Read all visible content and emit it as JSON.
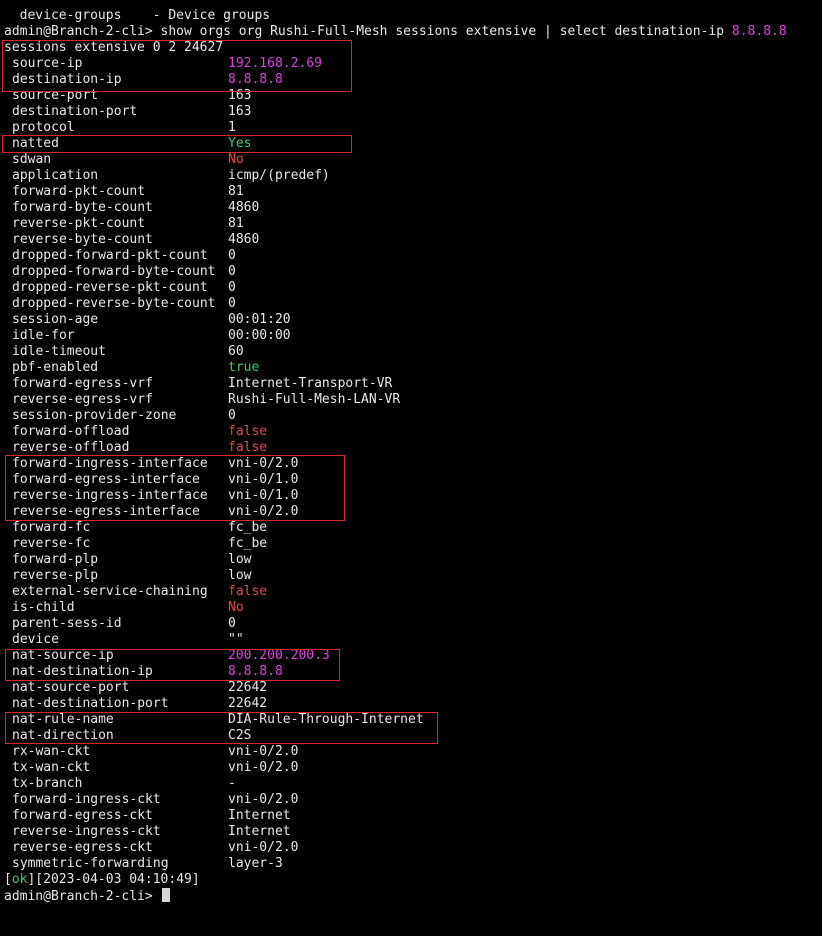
{
  "colors": {
    "background": "#000000",
    "default_text": "#e8e8e8",
    "magenta": "#e040e0",
    "green": "#3ccc6c",
    "red": "#e84848",
    "highlight_box": "#d4282f"
  },
  "header": {
    "device_groups_line": "  device-groups    - Device groups",
    "prompt_line_prefix": "admin@Branch-2-cli> show orgs org Rushi-Full-Mesh sessions extensive | select destination-ip ",
    "prompt_line_arg": "8.8.8.8",
    "session_title": "sessions extensive 0 2 24627"
  },
  "fields": [
    {
      "key": "source-ip",
      "value": "192.168.2.69",
      "color": "magenta"
    },
    {
      "key": "destination-ip",
      "value": "8.8.8.8",
      "color": "magenta"
    },
    {
      "key": "source-port",
      "value": "163",
      "color": "default"
    },
    {
      "key": "destination-port",
      "value": "163",
      "color": "default"
    },
    {
      "key": "protocol",
      "value": "1",
      "color": "default"
    },
    {
      "key": "natted",
      "value": "Yes",
      "color": "green"
    },
    {
      "key": "sdwan",
      "value": "No",
      "color": "red"
    },
    {
      "key": "application",
      "value": "icmp/(predef)",
      "color": "default"
    },
    {
      "key": "forward-pkt-count",
      "value": "81",
      "color": "default"
    },
    {
      "key": "forward-byte-count",
      "value": "4860",
      "color": "default"
    },
    {
      "key": "reverse-pkt-count",
      "value": "81",
      "color": "default"
    },
    {
      "key": "reverse-byte-count",
      "value": "4860",
      "color": "default"
    },
    {
      "key": "dropped-forward-pkt-count",
      "value": "0",
      "color": "default"
    },
    {
      "key": "dropped-forward-byte-count",
      "value": "0",
      "color": "default"
    },
    {
      "key": "dropped-reverse-pkt-count",
      "value": "0",
      "color": "default"
    },
    {
      "key": "dropped-reverse-byte-count",
      "value": "0",
      "color": "default"
    },
    {
      "key": "session-age",
      "value": "00:01:20",
      "color": "default"
    },
    {
      "key": "idle-for",
      "value": "00:00:00",
      "color": "default"
    },
    {
      "key": "idle-timeout",
      "value": "60",
      "color": "default"
    },
    {
      "key": "pbf-enabled",
      "value": "true",
      "color": "green"
    },
    {
      "key": "forward-egress-vrf",
      "value": "Internet-Transport-VR",
      "color": "default"
    },
    {
      "key": "reverse-egress-vrf",
      "value": "Rushi-Full-Mesh-LAN-VR",
      "color": "default"
    },
    {
      "key": "session-provider-zone",
      "value": "0",
      "color": "default"
    },
    {
      "key": "forward-offload",
      "value": "false",
      "color": "red"
    },
    {
      "key": "reverse-offload",
      "value": "false",
      "color": "red"
    },
    {
      "key": "forward-ingress-interface",
      "value": "vni-0/2.0",
      "color": "default"
    },
    {
      "key": "forward-egress-interface",
      "value": "vni-0/1.0",
      "color": "default"
    },
    {
      "key": "reverse-ingress-interface",
      "value": "vni-0/1.0",
      "color": "default"
    },
    {
      "key": "reverse-egress-interface",
      "value": "vni-0/2.0",
      "color": "default"
    },
    {
      "key": "forward-fc",
      "value": "fc_be",
      "color": "default"
    },
    {
      "key": "reverse-fc",
      "value": "fc_be",
      "color": "default"
    },
    {
      "key": "forward-plp",
      "value": "low",
      "color": "default"
    },
    {
      "key": "reverse-plp",
      "value": "low",
      "color": "default"
    },
    {
      "key": "external-service-chaining",
      "value": "false",
      "color": "red"
    },
    {
      "key": "is-child",
      "value": "No",
      "color": "red"
    },
    {
      "key": "parent-sess-id",
      "value": "0",
      "color": "default"
    },
    {
      "key": "device",
      "value": "\"\"",
      "color": "default"
    },
    {
      "key": "nat-source-ip",
      "value": "200.200.200.3",
      "color": "magenta"
    },
    {
      "key": "nat-destination-ip",
      "value": "8.8.8.8",
      "color": "magenta"
    },
    {
      "key": "nat-source-port",
      "value": "22642",
      "color": "default"
    },
    {
      "key": "nat-destination-port",
      "value": "22642",
      "color": "default"
    },
    {
      "key": "nat-rule-name",
      "value": "DIA-Rule-Through-Internet",
      "color": "default"
    },
    {
      "key": "nat-direction",
      "value": "C2S",
      "color": "default"
    },
    {
      "key": "rx-wan-ckt",
      "value": "vni-0/2.0",
      "color": "default"
    },
    {
      "key": "tx-wan-ckt",
      "value": "vni-0/2.0",
      "color": "default"
    },
    {
      "key": "tx-branch",
      "value": "-",
      "color": "default"
    },
    {
      "key": "forward-ingress-ckt",
      "value": "vni-0/2.0",
      "color": "default"
    },
    {
      "key": "forward-egress-ckt",
      "value": "Internet",
      "color": "default"
    },
    {
      "key": "reverse-ingress-ckt",
      "value": "Internet",
      "color": "default"
    },
    {
      "key": "reverse-egress-ckt",
      "value": "vni-0/2.0",
      "color": "default"
    },
    {
      "key": "symmetric-forwarding",
      "value": "layer-3",
      "color": "default"
    }
  ],
  "footer": {
    "status_open": "[",
    "status_ok": "ok",
    "status_rest": "][2023-04-03 04:10:49]",
    "final_prompt": "admin@Branch-2-cli> "
  }
}
